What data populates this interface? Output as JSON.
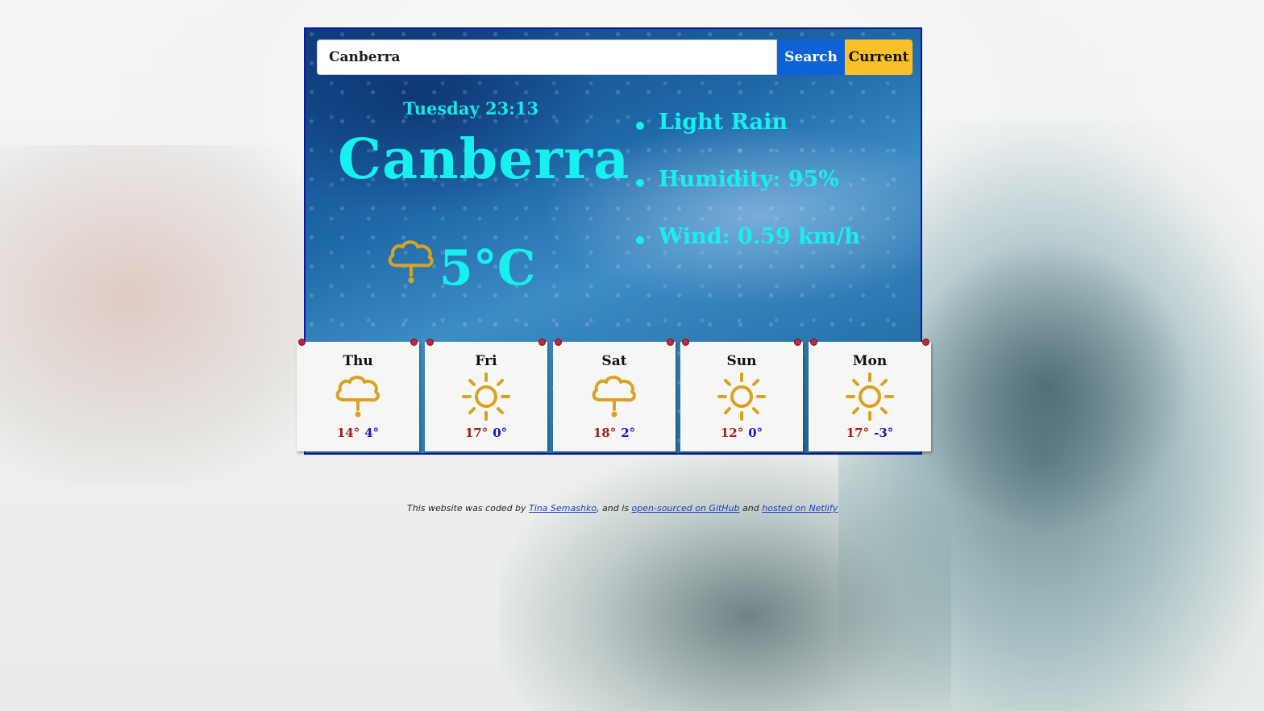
{
  "search": {
    "input_value": "Canberra",
    "search_label": "Search",
    "current_label": "Current"
  },
  "current": {
    "datetime": "Tuesday 23:13",
    "city": "Canberra",
    "temperature": "5°C",
    "icon": "rain-cloud-icon",
    "details": [
      "Light Rain",
      "Humidity: 95%",
      "Wind: 0.59 km/h"
    ]
  },
  "forecast": [
    {
      "day": "Thu",
      "icon": "rain-cloud-icon",
      "high": "14°",
      "low": "4°"
    },
    {
      "day": "Fri",
      "icon": "sun-icon",
      "high": "17°",
      "low": "0°"
    },
    {
      "day": "Sat",
      "icon": "rain-cloud-icon",
      "high": "18°",
      "low": "2°"
    },
    {
      "day": "Sun",
      "icon": "sun-icon",
      "high": "12°",
      "low": "0°"
    },
    {
      "day": "Mon",
      "icon": "sun-icon",
      "high": "17°",
      "low": "-3°"
    }
  ],
  "footer": {
    "prefix": "This website was coded by",
    "author": "Tina Semashko",
    "middle": ", and is",
    "github": "open-sourced on GitHub",
    "and": "and",
    "netlify": "hosted on Netlify"
  },
  "colors": {
    "accent_cyan": "#18f0f0",
    "search_button": "#0d62d6",
    "current_button": "#f8c12a",
    "high_temp": "#9c1d1d",
    "low_temp": "#1616c8",
    "icon_gold": "#d9a223"
  }
}
